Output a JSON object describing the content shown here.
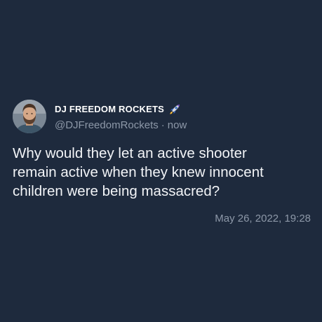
{
  "tweet": {
    "author": {
      "display_name": "DJ FREEDOM ROCKETS",
      "badge_icon": "rocket-icon",
      "handle": "@DJFreedomRockets",
      "separator": "·",
      "relative_time": "now",
      "avatar_icon": "avatar-bearded-man"
    },
    "lines": [
      "Why would they let an active shooter",
      "remain active when they knew innocent",
      "children were being massacred?"
    ],
    "timestamp": "May 26, 2022, 19:28"
  },
  "colors": {
    "background": "#1e2a3d",
    "text_primary": "#ffffff",
    "text_secondary": "#8d98a8"
  }
}
